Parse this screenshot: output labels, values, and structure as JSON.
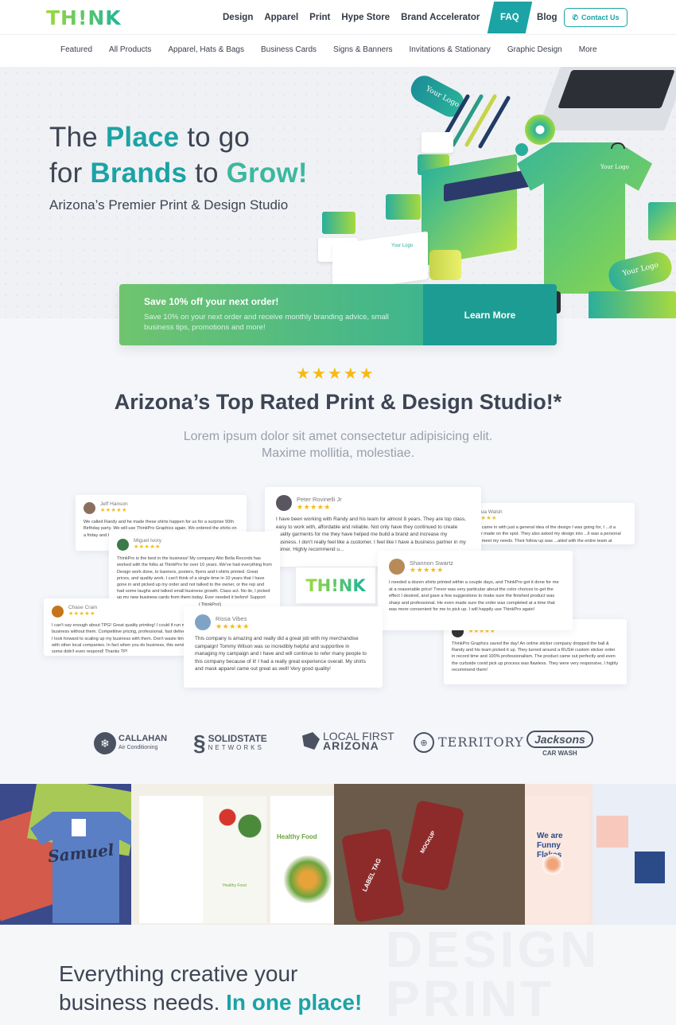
{
  "brand": {
    "logo": "TH!NK",
    "accent": "#1ba3a5",
    "green": "#6fc46e",
    "star": "#f4bb16"
  },
  "nav": {
    "items": [
      "Design",
      "Apparel",
      "Print",
      "Hype Store",
      "Brand Accelerator",
      "FAQ",
      "Blog"
    ],
    "active": "FAQ",
    "contact": "Contact Us"
  },
  "subnav": [
    "Featured",
    "All Products",
    "Apparel, Hats & Bags",
    "Business Cards",
    "Signs & Banners",
    "Invitations & Stationary",
    "Graphic Design",
    "More"
  ],
  "hero": {
    "l1a": "The ",
    "l1b": "Place",
    "l1c": " to go",
    "l2a": "for ",
    "l2b": "Brands",
    "l2c": " to ",
    "l2d": "Grow!",
    "subtitle": "Arizona’s Premier Print & Design Studio",
    "mockup_text": {
      "cup": "Your Logo",
      "shirt": "Your Logo",
      "card": "Your Logo",
      "folder": "Your Logo"
    }
  },
  "promo": {
    "title": "Save 10% off your next order!",
    "text": "Save 10% on your next order and receive monthly branding advice, small business tips, promotions and more!",
    "button": "Learn More"
  },
  "rated": {
    "stars": "★★★★★",
    "title": "Arizona’s Top Rated Print & Design Studio!*",
    "lorem1": "Lorem ipsum dolor sit amet consectetur adipisicing elit.",
    "lorem2": "Maxime mollitia, molestiae."
  },
  "reviews": [
    {
      "name": "Jeff Hanson",
      "stars": "★★★★★",
      "text": "We called Randy and he made these shirts happen for us for a surprise 50th Birthday party. We will use ThinkPro Graphics again. We ordered the shirts on a friday and they were ready on Monday. Great work!"
    },
    {
      "name": "Peter Rovinelli Jr",
      "stars": "★★★★★",
      "text": "I have been working with Randy and his team for almost 8 years. They are top class, easy to work with, affordable and reliable. Not only have they continued to create quality garments for me they have helped me build a brand and increase my business. I don't really feel like a customer. I feel like I have a business partner in my corner. Highly recommend u..."
    },
    {
      "name": "Joshua Walsh",
      "stars": "★★★★★",
      "text": "...ible service, came in with just a general idea of the design I was going for, I ...d a custom vendor made on the spot. They also asked my design into ...ll was a personal gift in order to meet my needs. Their follow up was ...ailed with the entire team at"
    },
    {
      "name": "Miguel Ivory",
      "stars": "★★★★★",
      "text": "ThinkPro is the best in the business! My company Alto Bella Records has worked with the folks at ThinkPro for over 10 years. We've had everything from Design work done, to banners, posters, flyers and t-shirts printed. Great prices, and quality work. I can't think of a single time in 10 years that I have gone in and picked up my order and not talked to the owner, or the rep and had some laughs and talked small business growth. Class act. No lie, I picked up my new business cards from them today. Ever needed it before! Support your local business, and call them up! (*Hi ThinkPro!)"
    },
    {
      "name": "Shannon Swartz",
      "stars": "★★★★★",
      "text": "I needed a dozen shirts printed within a couple days, and ThinkPro got it done for me at a reasonable price! Trevor was very particular about the color choices to get the effect I desired, and gave a few suggestions to make sure the finished product was sharp and professional. He even made sure the order was completed at a time that was more convenient for me to pick up. I will happily use ThinkPro again!"
    },
    {
      "name": "Chase Crain",
      "stars": "★★★★★",
      "text": "I can't say enough about TPG! Great quality printing! I could if run my business without them. Competitive pricing, professional, fast delivery. I look forward to scaling up my business with them. Don't waste time with other local companies. In fact when you do business, this service, some didn't even respond! Thanks TP!"
    },
    {
      "name": "Rissa Vibes",
      "stars": "★★★★★",
      "text": "This company is amazing and really did a great job with my merchandise campaign! Tommy Wilson was so incredibly helpful and supportive in managing my campaign and I have and will continue to refer many people to this company because of it! I had a really great experience overall. My shirts and mask apparel came out great as well! Very good quality!"
    },
    {
      "name": "",
      "stars": "★★★★★",
      "text": "ThinkPro Graphics saved the day! An online sticker company dropped the ball & Randy and his team picked it up. They turned around a RUSH custom sticker order in record time and 100% professionalism. The product came out perfectly and even the curbside covid pick up process was flawless. They were very responsive, I highly recommend them!"
    }
  ],
  "review_logo": "TH!NK",
  "clients": [
    {
      "name": "CALLAHAN",
      "sub": "Air Conditioning"
    },
    {
      "name": "SOLIDSTATE",
      "sub": "NETWORKS"
    },
    {
      "name": "LOCAL FIRST",
      "sub": "ARIZONA"
    },
    {
      "name": "TERRITORY",
      "sub": ""
    },
    {
      "name": "Jacksons",
      "sub": "CAR WASH"
    }
  ],
  "gallery": {
    "shirt_text": "Samuel",
    "brochure_title": "Healthy Food",
    "brochure_small": "Healthy Food",
    "tag_text": "LABEL TAG",
    "tag_sub": "MOCKUP",
    "flakes_title": "We are Funny Flakes"
  },
  "bottom": {
    "l1": "Everything creative your",
    "l2a": "business needs. ",
    "l2b": "In one place!",
    "ghost1": "DESIGN",
    "ghost2": "PRINT"
  }
}
